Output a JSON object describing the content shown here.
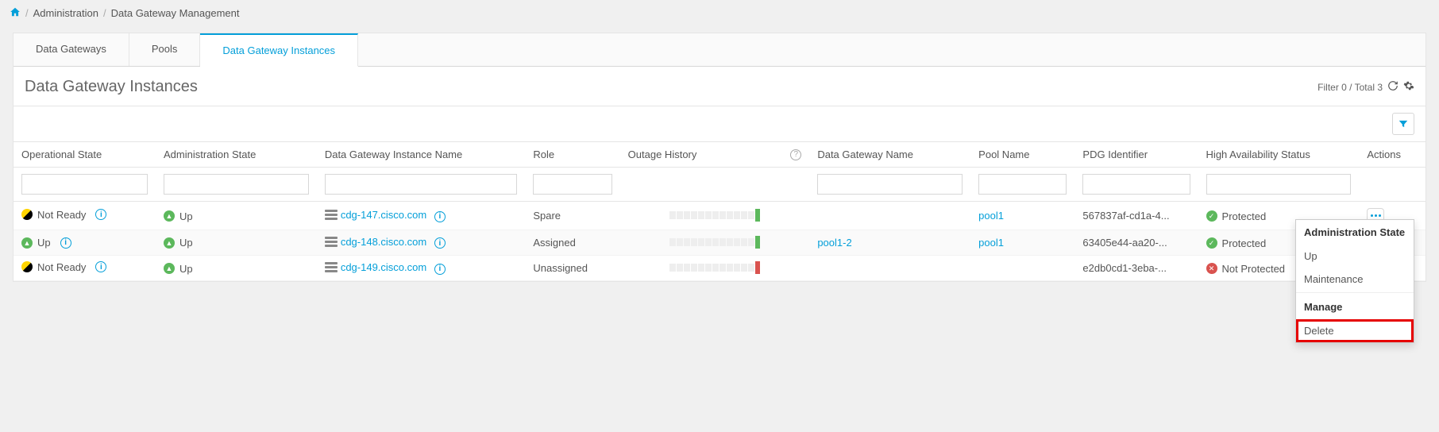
{
  "breadcrumb": {
    "home_label": "Home",
    "items": [
      "Administration",
      "Data Gateway Management"
    ]
  },
  "tabs": [
    {
      "label": "Data Gateways"
    },
    {
      "label": "Pools"
    },
    {
      "label": "Data Gateway Instances"
    }
  ],
  "section": {
    "title": "Data Gateway Instances",
    "filter_summary": "Filter 0 / Total 3"
  },
  "columns": {
    "op_state": "Operational State",
    "admin_state": "Administration State",
    "instance_name": "Data Gateway Instance Name",
    "role": "Role",
    "outage": "Outage History",
    "gw_name": "Data Gateway Name",
    "pool": "Pool Name",
    "pdg": "PDG Identifier",
    "ha": "High Availability Status",
    "actions": "Actions"
  },
  "rows": [
    {
      "op_state": {
        "icon": "notready",
        "label": "Not Ready"
      },
      "admin_state": {
        "icon": "up",
        "label": "Up"
      },
      "instance_name": "cdg-147.cisco.com",
      "role": "Spare",
      "outage_end": "green",
      "gw_name": "",
      "pool": "pool1",
      "pdg": "567837af-cd1a-4...",
      "ha": {
        "icon": "check",
        "label": "Protected"
      }
    },
    {
      "op_state": {
        "icon": "up",
        "label": "Up"
      },
      "admin_state": {
        "icon": "up",
        "label": "Up"
      },
      "instance_name": "cdg-148.cisco.com",
      "role": "Assigned",
      "outage_end": "green",
      "gw_name": "pool1-2",
      "pool": "pool1",
      "pdg": "63405e44-aa20-...",
      "ha": {
        "icon": "check",
        "label": "Protected"
      }
    },
    {
      "op_state": {
        "icon": "notready",
        "label": "Not Ready"
      },
      "admin_state": {
        "icon": "up",
        "label": "Up"
      },
      "instance_name": "cdg-149.cisco.com",
      "role": "Unassigned",
      "outage_end": "red",
      "gw_name": "",
      "pool": "",
      "pdg": "e2db0cd1-3eba-...",
      "ha": {
        "icon": "x",
        "label": "Not Protected"
      }
    }
  ],
  "dropdown": {
    "header1": "Administration State",
    "item_up": "Up",
    "item_maint": "Maintenance",
    "header2": "Manage",
    "item_delete": "Delete"
  }
}
